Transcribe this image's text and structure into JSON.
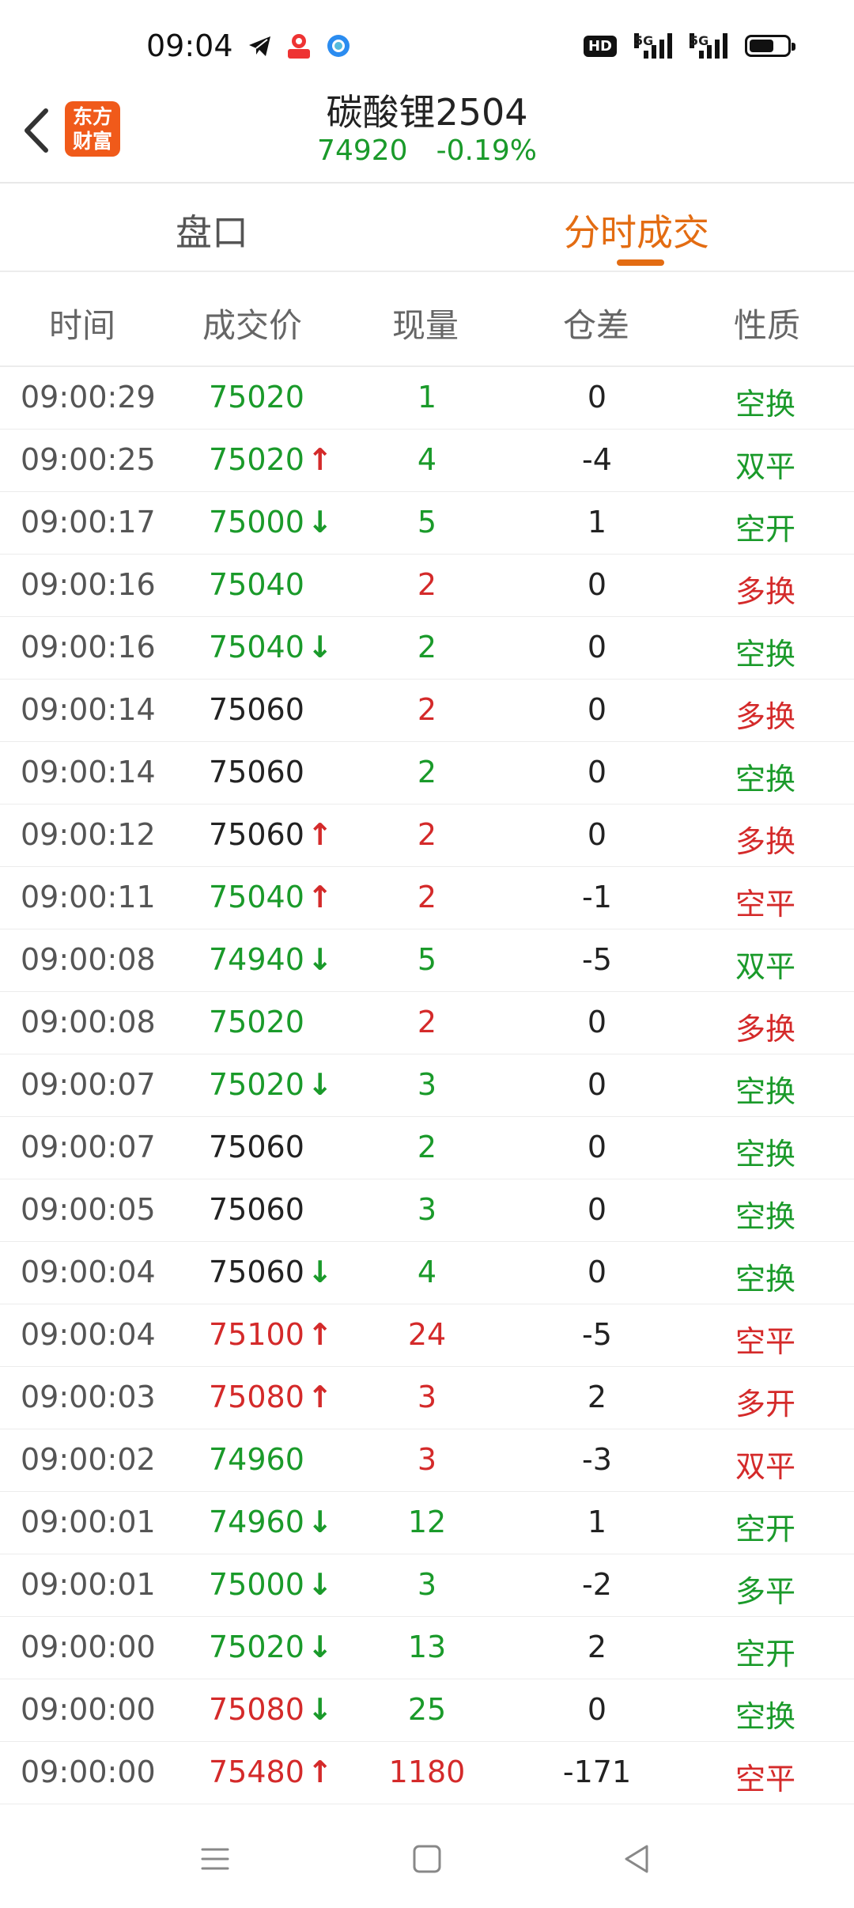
{
  "status": {
    "time": "09:04",
    "hd_label": "HD",
    "net1": "5G",
    "net2": "5G"
  },
  "header": {
    "logo": "东方\n财富",
    "logo_line1": "东方",
    "logo_line2": "财富",
    "title": "碳酸锂2504",
    "price": "74920",
    "change": "-0.19%"
  },
  "tabs": [
    {
      "label": "盘口",
      "active": false
    },
    {
      "label": "分时成交",
      "active": true
    }
  ],
  "columns": [
    "时间",
    "成交价",
    "现量",
    "仓差",
    "性质"
  ],
  "colors": {
    "up": "#d42a2a",
    "down": "#1a9a2a",
    "neutral": "#222222",
    "accent": "#e36c12",
    "logo": "#f05a1a"
  },
  "trades": [
    {
      "time": "09:00:29",
      "price": "75020",
      "pc": "green",
      "arrow": "",
      "vol": "1",
      "vc": "green",
      "oi": "0",
      "nature": "空换",
      "nc": "green"
    },
    {
      "time": "09:00:25",
      "price": "75020",
      "pc": "green",
      "arrow": "up",
      "vol": "4",
      "vc": "green",
      "oi": "-4",
      "nature": "双平",
      "nc": "green"
    },
    {
      "time": "09:00:17",
      "price": "75000",
      "pc": "green",
      "arrow": "down",
      "vol": "5",
      "vc": "green",
      "oi": "1",
      "nature": "空开",
      "nc": "green"
    },
    {
      "time": "09:00:16",
      "price": "75040",
      "pc": "green",
      "arrow": "",
      "vol": "2",
      "vc": "red",
      "oi": "0",
      "nature": "多换",
      "nc": "red"
    },
    {
      "time": "09:00:16",
      "price": "75040",
      "pc": "green",
      "arrow": "down",
      "vol": "2",
      "vc": "green",
      "oi": "0",
      "nature": "空换",
      "nc": "green"
    },
    {
      "time": "09:00:14",
      "price": "75060",
      "pc": "black",
      "arrow": "",
      "vol": "2",
      "vc": "red",
      "oi": "0",
      "nature": "多换",
      "nc": "red"
    },
    {
      "time": "09:00:14",
      "price": "75060",
      "pc": "black",
      "arrow": "",
      "vol": "2",
      "vc": "green",
      "oi": "0",
      "nature": "空换",
      "nc": "green"
    },
    {
      "time": "09:00:12",
      "price": "75060",
      "pc": "black",
      "arrow": "up",
      "vol": "2",
      "vc": "red",
      "oi": "0",
      "nature": "多换",
      "nc": "red"
    },
    {
      "time": "09:00:11",
      "price": "75040",
      "pc": "green",
      "arrow": "up",
      "vol": "2",
      "vc": "red",
      "oi": "-1",
      "nature": "空平",
      "nc": "red"
    },
    {
      "time": "09:00:08",
      "price": "74940",
      "pc": "green",
      "arrow": "down",
      "vol": "5",
      "vc": "green",
      "oi": "-5",
      "nature": "双平",
      "nc": "green"
    },
    {
      "time": "09:00:08",
      "price": "75020",
      "pc": "green",
      "arrow": "",
      "vol": "2",
      "vc": "red",
      "oi": "0",
      "nature": "多换",
      "nc": "red"
    },
    {
      "time": "09:00:07",
      "price": "75020",
      "pc": "green",
      "arrow": "down",
      "vol": "3",
      "vc": "green",
      "oi": "0",
      "nature": "空换",
      "nc": "green"
    },
    {
      "time": "09:00:07",
      "price": "75060",
      "pc": "black",
      "arrow": "",
      "vol": "2",
      "vc": "green",
      "oi": "0",
      "nature": "空换",
      "nc": "green"
    },
    {
      "time": "09:00:05",
      "price": "75060",
      "pc": "black",
      "arrow": "",
      "vol": "3",
      "vc": "green",
      "oi": "0",
      "nature": "空换",
      "nc": "green"
    },
    {
      "time": "09:00:04",
      "price": "75060",
      "pc": "black",
      "arrow": "down",
      "vol": "4",
      "vc": "green",
      "oi": "0",
      "nature": "空换",
      "nc": "green"
    },
    {
      "time": "09:00:04",
      "price": "75100",
      "pc": "red",
      "arrow": "up",
      "vol": "24",
      "vc": "red",
      "oi": "-5",
      "nature": "空平",
      "nc": "red"
    },
    {
      "time": "09:00:03",
      "price": "75080",
      "pc": "red",
      "arrow": "up",
      "vol": "3",
      "vc": "red",
      "oi": "2",
      "nature": "多开",
      "nc": "red"
    },
    {
      "time": "09:00:02",
      "price": "74960",
      "pc": "green",
      "arrow": "",
      "vol": "3",
      "vc": "red",
      "oi": "-3",
      "nature": "双平",
      "nc": "red"
    },
    {
      "time": "09:00:01",
      "price": "74960",
      "pc": "green",
      "arrow": "down",
      "vol": "12",
      "vc": "green",
      "oi": "1",
      "nature": "空开",
      "nc": "green"
    },
    {
      "time": "09:00:01",
      "price": "75000",
      "pc": "green",
      "arrow": "down",
      "vol": "3",
      "vc": "green",
      "oi": "-2",
      "nature": "多平",
      "nc": "green"
    },
    {
      "time": "09:00:00",
      "price": "75020",
      "pc": "green",
      "arrow": "down",
      "vol": "13",
      "vc": "green",
      "oi": "2",
      "nature": "空开",
      "nc": "green"
    },
    {
      "time": "09:00:00",
      "price": "75080",
      "pc": "red",
      "arrow": "down",
      "vol": "25",
      "vc": "green",
      "oi": "0",
      "nature": "空换",
      "nc": "green"
    },
    {
      "time": "09:00:00",
      "price": "75480",
      "pc": "red",
      "arrow": "up",
      "vol": "1180",
      "vc": "red",
      "oi": "-171",
      "nature": "空平",
      "nc": "red"
    }
  ],
  "navbar": [
    "menu-icon",
    "home-icon",
    "back-triangle-icon"
  ]
}
